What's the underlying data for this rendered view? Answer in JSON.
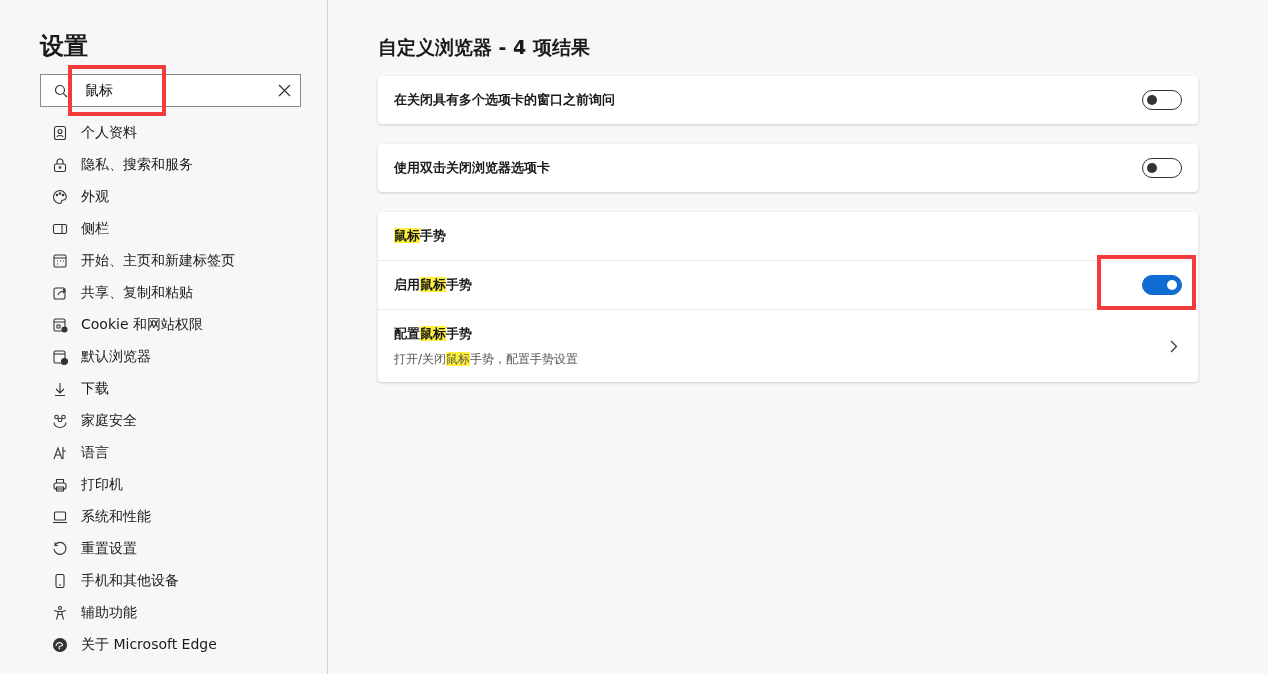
{
  "sidebar": {
    "title": "设置",
    "search": {
      "value": "鼠标",
      "annotated": true
    },
    "items": [
      {
        "label": "个人资料"
      },
      {
        "label": "隐私、搜索和服务"
      },
      {
        "label": "外观"
      },
      {
        "label": "侧栏"
      },
      {
        "label": "开始、主页和新建标签页"
      },
      {
        "label": "共享、复制和粘贴"
      },
      {
        "label": "Cookie 和网站权限"
      },
      {
        "label": "默认浏览器"
      },
      {
        "label": "下载"
      },
      {
        "label": "家庭安全"
      },
      {
        "label": "语言"
      },
      {
        "label": "打印机"
      },
      {
        "label": "系统和性能"
      },
      {
        "label": "重置设置"
      },
      {
        "label": "手机和其他设备"
      },
      {
        "label": "辅助功能"
      },
      {
        "label": "关于 Microsoft Edge"
      }
    ]
  },
  "main": {
    "title": "自定义浏览器 - 4 项结果",
    "cards": [
      {
        "rows": [
          {
            "kind": "toggle",
            "label": [
              {
                "text": "在关闭具有多个选项卡的窗口之前询问",
                "highlighted": false
              }
            ],
            "on": false,
            "annotated": false
          }
        ]
      },
      {
        "rows": [
          {
            "kind": "toggle",
            "label": [
              {
                "text": "使用双击关闭浏览器选项卡",
                "highlighted": false
              }
            ],
            "on": false,
            "annotated": false
          }
        ]
      },
      {
        "rows": [
          {
            "kind": "header",
            "label": [
              {
                "text": "鼠标",
                "highlighted": true
              },
              {
                "text": "手势",
                "highlighted": false
              }
            ]
          },
          {
            "kind": "toggle",
            "label": [
              {
                "text": "启用",
                "highlighted": false
              },
              {
                "text": "鼠标",
                "highlighted": true
              },
              {
                "text": "手势",
                "highlighted": false
              }
            ],
            "on": true,
            "annotated": true
          },
          {
            "kind": "link",
            "label": [
              {
                "text": "配置",
                "highlighted": false
              },
              {
                "text": "鼠标",
                "highlighted": true
              },
              {
                "text": "手势",
                "highlighted": false
              }
            ],
            "description": [
              {
                "text": "打开/关闭",
                "highlighted": false
              },
              {
                "text": "鼠标",
                "highlighted": true
              },
              {
                "text": "手势，配置手势设置",
                "highlighted": false
              }
            ]
          }
        ]
      }
    ]
  }
}
